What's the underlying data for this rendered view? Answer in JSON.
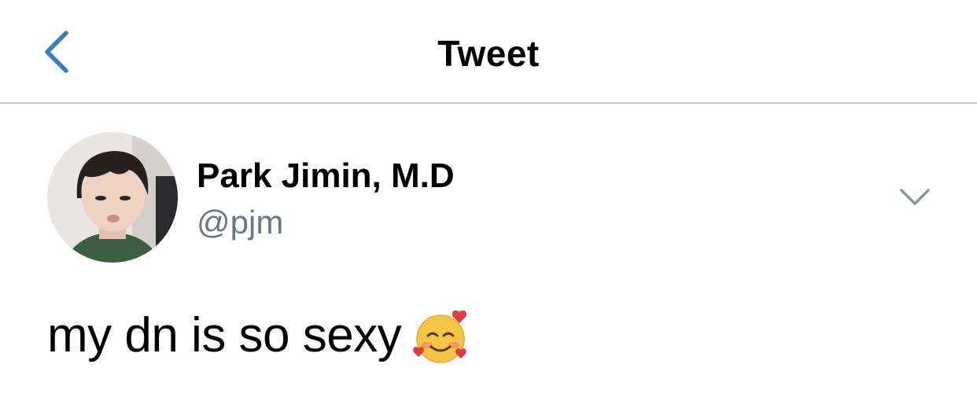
{
  "header": {
    "title": "Tweet",
    "back_icon": "chevron-left-icon"
  },
  "tweet": {
    "author": {
      "display_name": "Park Jimin, M.D",
      "handle": "@pjm",
      "avatar": "profile-photo"
    },
    "text": "my dn is so sexy",
    "emoji": "smiling-face-with-hearts",
    "more_icon": "chevron-down-icon"
  },
  "colors": {
    "accent": "#3a7bbf",
    "secondary_text": "#6b7785",
    "divider": "#c8c8cc"
  }
}
